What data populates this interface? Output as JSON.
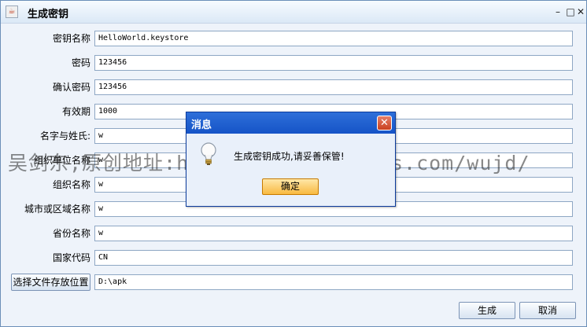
{
  "window": {
    "title": "生成密钥"
  },
  "form": {
    "rows": [
      {
        "label": "密钥名称",
        "value": "HelloWorld.keystore"
      },
      {
        "label": "密码",
        "value": "123456"
      },
      {
        "label": "确认密码",
        "value": "123456"
      },
      {
        "label": "有效期",
        "value": "1000"
      },
      {
        "label": "名字与姓氏:",
        "value": "w"
      },
      {
        "label": "组织单位名称",
        "value": "w"
      },
      {
        "label": "组织名称",
        "value": "w"
      },
      {
        "label": "城市或区域名称",
        "value": "w"
      },
      {
        "label": "省份名称",
        "value": "w"
      },
      {
        "label": "国家代码",
        "value": "CN"
      }
    ],
    "choose_location_label": "选择文件存放位置",
    "location_value": "D:\\apk"
  },
  "buttons": {
    "generate": "生成",
    "cancel": "取消"
  },
  "dialog": {
    "title": "消息",
    "message": "生成密钥成功,请妥善保管!",
    "ok": "确定",
    "icon": "lightbulb-icon"
  },
  "watermark": "吴剑东,原创地址:http://www.cnblogs.com/wujd/",
  "colors": {
    "dialog_title": "#1f5fd0",
    "ok_button": "#f8b940"
  }
}
